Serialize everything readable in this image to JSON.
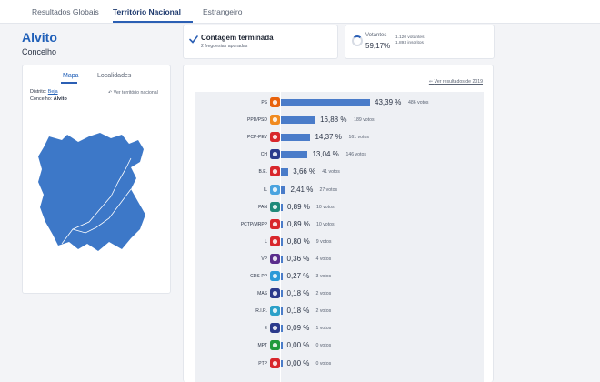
{
  "nav": {
    "tabs": [
      {
        "label": "Resultados Globais"
      },
      {
        "label": "Território Nacional"
      },
      {
        "label": "Estrangeiro"
      }
    ]
  },
  "place": {
    "name": "Alvito",
    "type": "Concelho"
  },
  "status": {
    "title": "Contagem terminada",
    "subtitle": "2 freguesias apuradas"
  },
  "voters": {
    "label": "Votantes",
    "percent": "59,17%",
    "voters_count": "1.120 votantes",
    "registered": "1.893 inscritos",
    "ring_fraction": 0.59
  },
  "map": {
    "tabs": [
      {
        "label": "Mapa"
      },
      {
        "label": "Localidades"
      }
    ],
    "district_label": "Distrito:",
    "district_value": "Beja",
    "council_label": "Concelho:",
    "council_value": "Alvito",
    "back_link": "Ver território nacional",
    "fill_color": "#3d78c8"
  },
  "results": {
    "previous_link": "Ver resultados de 2019",
    "bar_color": "#4a7cc9",
    "parties": [
      {
        "name": "PS",
        "percent": 43.39,
        "percent_label": "43,39 %",
        "votes": "486 votos",
        "icon": "ps-rose-icon",
        "color": "#e8620c"
      },
      {
        "name": "PPD/PSD",
        "percent": 16.88,
        "percent_label": "16,88 %",
        "votes": "189 votos",
        "icon": "psd-arrows-icon",
        "color": "#f08a1f"
      },
      {
        "name": "PCP-PEV",
        "percent": 14.37,
        "percent_label": "14,37 %",
        "votes": "161 votos",
        "icon": "cdu-hammer-icon",
        "color": "#d8262c"
      },
      {
        "name": "CH",
        "percent": 13.04,
        "percent_label": "13,04 %",
        "votes": "146 votos",
        "icon": "chega-icon",
        "color": "#2b3a8c"
      },
      {
        "name": "B.E.",
        "percent": 3.66,
        "percent_label": "3,66 %",
        "votes": "41 votos",
        "icon": "be-star-icon",
        "color": "#d8262c"
      },
      {
        "name": "IL",
        "percent": 2.41,
        "percent_label": "2,41 %",
        "votes": "27 votos",
        "icon": "il-icon",
        "color": "#4aa3df"
      },
      {
        "name": "PAN",
        "percent": 0.89,
        "percent_label": "0,89 %",
        "votes": "10 votos",
        "icon": "pan-leaf-icon",
        "color": "#1f8a7a"
      },
      {
        "name": "PCTP/MRPP",
        "percent": 0.89,
        "percent_label": "0,89 %",
        "votes": "10 votos",
        "icon": "mrpp-icon",
        "color": "#d8262c"
      },
      {
        "name": "L",
        "percent": 0.8,
        "percent_label": "0,80 %",
        "votes": "9 votos",
        "icon": "livre-icon",
        "color": "#d8262c"
      },
      {
        "name": "VP",
        "percent": 0.36,
        "percent_label": "0,36 %",
        "votes": "4 votos",
        "icon": "volt-icon",
        "color": "#5a2c8c"
      },
      {
        "name": "CDS-PP",
        "percent": 0.27,
        "percent_label": "0,27 %",
        "votes": "3 votos",
        "icon": "cds-icon",
        "color": "#2b9ad8"
      },
      {
        "name": "MAS",
        "percent": 0.18,
        "percent_label": "0,18 %",
        "votes": "2 votos",
        "icon": "mas-icon",
        "color": "#2b3a8c"
      },
      {
        "name": "R.I.R.",
        "percent": 0.18,
        "percent_label": "0,18 %",
        "votes": "2 votos",
        "icon": "rir-icon",
        "color": "#2ba0c8"
      },
      {
        "name": "E",
        "percent": 0.09,
        "percent_label": "0,09 %",
        "votes": "1 votos",
        "icon": "ergue-te-icon",
        "color": "#2b3a8c"
      },
      {
        "name": "MPT",
        "percent": 0.0,
        "percent_label": "0,00 %",
        "votes": "0 votos",
        "icon": "mpt-clover-icon",
        "color": "#1f9a3a"
      },
      {
        "name": "PTP",
        "percent": 0.0,
        "percent_label": "0,00 %",
        "votes": "0 votos",
        "icon": "ptp-icon",
        "color": "#d8262c"
      }
    ]
  }
}
